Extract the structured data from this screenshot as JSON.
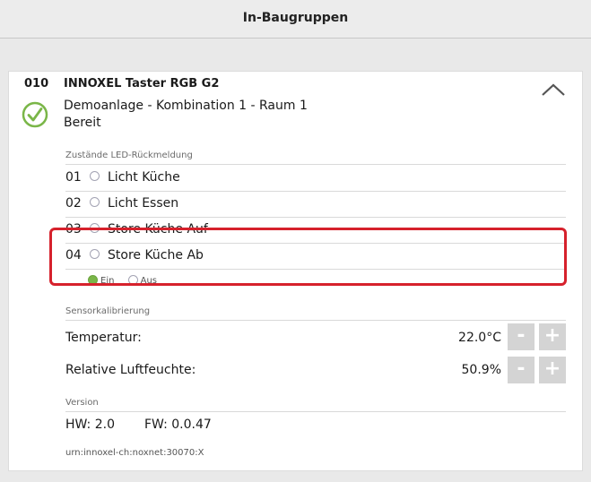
{
  "header": {
    "title": "In-Baugruppen"
  },
  "device": {
    "number": "010",
    "name": "INNOXEL Taster RGB G2",
    "location": "Demoanlage - Kombination 1 - Raum 1",
    "status": "Bereit",
    "status_icon": "check-circle-icon",
    "collapse_icon": "chevron-up-icon"
  },
  "led_section": {
    "label": "Zustände LED-Rückmeldung",
    "items": [
      {
        "num": "01",
        "label": "Licht Küche"
      },
      {
        "num": "02",
        "label": "Licht Essen"
      },
      {
        "num": "03",
        "label": "Store Küche Auf"
      },
      {
        "num": "04",
        "label": "Store Küche Ab"
      }
    ],
    "legend_on": "Ein",
    "legend_off": "Aus",
    "on_color": "#7ab648"
  },
  "calibration": {
    "label": "Sensorkalibrierung",
    "temperature": {
      "label": "Temperatur:",
      "value": "22.0°C",
      "minus": "-",
      "plus": "+"
    },
    "humidity": {
      "label": "Relative Luftfeuchte:",
      "value": "50.9%",
      "minus": "-",
      "plus": "+"
    },
    "highlight_color": "#d6212c"
  },
  "version": {
    "label": "Version",
    "hw": "HW: 2.0",
    "fw": "FW: 0.0.47"
  },
  "urn": "urn:innoxel-ch:noxnet:30070:X"
}
